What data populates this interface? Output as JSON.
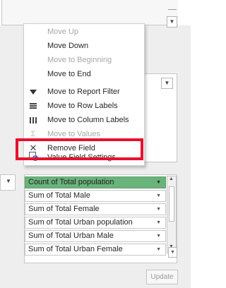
{
  "context_menu": {
    "items": [
      {
        "label": "Move Up",
        "icon": "",
        "enabled": false
      },
      {
        "label": "Move Down",
        "icon": "",
        "enabled": true
      },
      {
        "label": "Move to Beginning",
        "icon": "",
        "enabled": false
      },
      {
        "label": "Move to End",
        "icon": "",
        "enabled": true
      },
      {
        "label": "Move to Report Filter",
        "icon": "filter-icon",
        "enabled": true
      },
      {
        "label": "Move to Row Labels",
        "icon": "rows-icon",
        "enabled": true
      },
      {
        "label": "Move to Column Labels",
        "icon": "columns-icon",
        "enabled": true
      },
      {
        "label": "Move to Values",
        "icon": "sigma-icon",
        "enabled": false,
        "glyph": "Σ"
      },
      {
        "label": "Remove Field",
        "icon": "remove-icon",
        "enabled": true,
        "glyph": "✕"
      },
      {
        "label": "Value Field Settings...",
        "icon": "value-field-settings-icon",
        "enabled": true,
        "highlighted": true
      }
    ]
  },
  "values_area": {
    "fields": [
      {
        "label": "Count of Total population",
        "selected": true
      },
      {
        "label": "Sum of Total Male",
        "selected": false
      },
      {
        "label": "Sum of Total Female",
        "selected": false
      },
      {
        "label": "Sum of Total Urban population",
        "selected": false
      },
      {
        "label": "Sum of Total Urban Male",
        "selected": false
      },
      {
        "label": "Sum of Total Urban Female",
        "selected": false
      }
    ]
  },
  "footer": {
    "update_label": "Update",
    "update_enabled": false
  },
  "colors": {
    "selected_field": "#6ab37a",
    "highlight_box": "#e8112d",
    "disabled_text": "#a7a7a7"
  }
}
